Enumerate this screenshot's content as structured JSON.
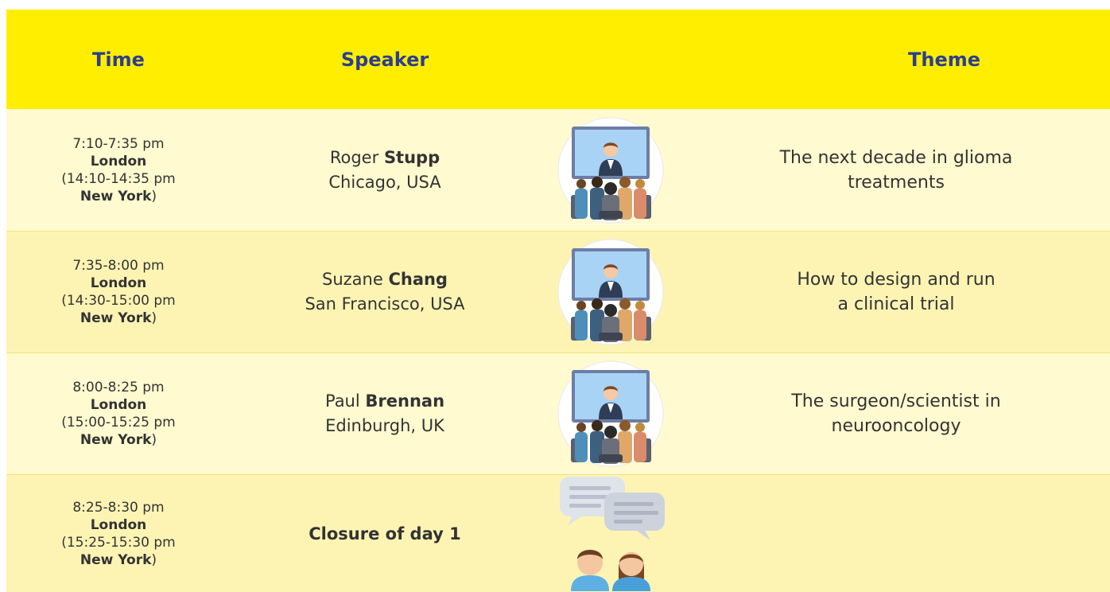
{
  "header": {
    "time": "Time",
    "speaker": "Speaker",
    "theme": "Theme"
  },
  "rows": [
    {
      "time_range": "7:10-7:35 pm",
      "time_city": "London",
      "alt_range": "(14:10-14:35 pm",
      "alt_city": "New York",
      "alt_close": ")",
      "first_name": "Roger",
      "last_name": "Stupp",
      "location": "Chicago, USA",
      "theme_line1": "The next decade in glioma",
      "theme_line2": "treatments",
      "icon": "presentation-icon"
    },
    {
      "time_range": "7:35-8:00 pm",
      "time_city": "London",
      "alt_range": "(14:30-15:00 pm",
      "alt_city": "New York",
      "alt_close": ")",
      "first_name": "Suzane",
      "last_name": "Chang",
      "location": "San Francisco, USA",
      "theme_line1": "How to design and run",
      "theme_line2": "a clinical trial",
      "icon": "presentation-icon"
    },
    {
      "time_range": "8:00-8:25 pm",
      "time_city": "London",
      "alt_range": "(15:00-15:25 pm",
      "alt_city": "New York",
      "alt_close": ")",
      "first_name": "Paul",
      "last_name": "Brennan",
      "location": "Edinburgh, UK",
      "theme_line1": "The surgeon/scientist in",
      "theme_line2": "neurooncology",
      "icon": "presentation-icon"
    },
    {
      "time_range": "8:25-8:30 pm",
      "time_city": "London",
      "alt_range": "(15:25-15:30 pm",
      "alt_city": "New York",
      "alt_close": ")",
      "closure": "Closure of day 1",
      "icon": "conversation-icon"
    }
  ],
  "colors": {
    "header_bg": "#ffee00",
    "header_text": "#2c3e91",
    "row_light": "#fffad0",
    "row_dark": "#fdf4b4"
  }
}
